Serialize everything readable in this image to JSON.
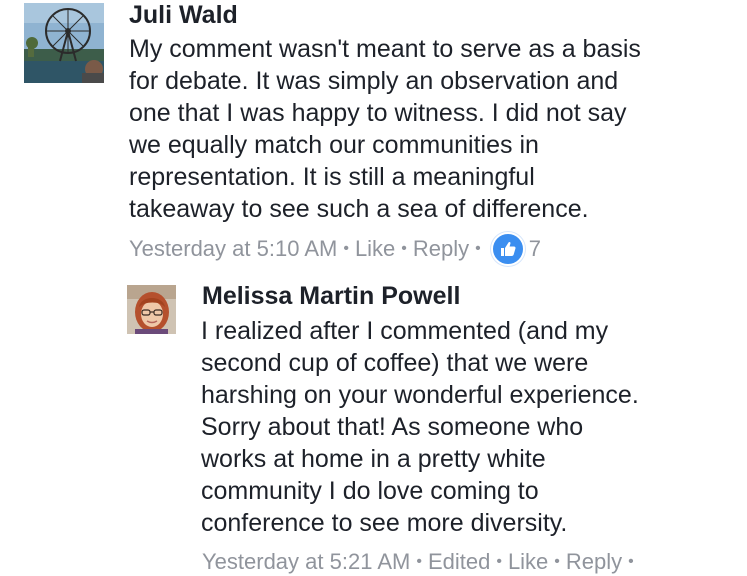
{
  "comments": [
    {
      "author": "Juli Wald",
      "lines": [
        "My comment wasn't meant to serve as a basis",
        "for debate. It was simply an observation and",
        "one that I was happy to witness. I did not say",
        "we equally match our communities in",
        "representation. It is still a meaningful",
        "takeaway to see such a sea of difference."
      ],
      "timestamp": "Yesterday at 5:10 AM",
      "like_label": "Like",
      "reply_label": "Reply",
      "reaction_count": "7",
      "reaction_icon": "thumbs-up-icon",
      "reaction_color": "#3b8ef0"
    },
    {
      "author": "Melissa Martin Powell",
      "lines": [
        "I realized after I commented (and my",
        "second cup of coffee)  that we were",
        "harshing on your wonderful experience.",
        "Sorry about that! As someone who",
        "works at home in a pretty white",
        "community I do love coming to",
        "conference to see more diversity."
      ],
      "timestamp": "Yesterday at 5:21 AM",
      "edited_label": "Edited",
      "like_label": "Like",
      "reply_label": "Reply"
    }
  ],
  "colors": {
    "text": "#1d2129",
    "meta": "#90949c"
  }
}
